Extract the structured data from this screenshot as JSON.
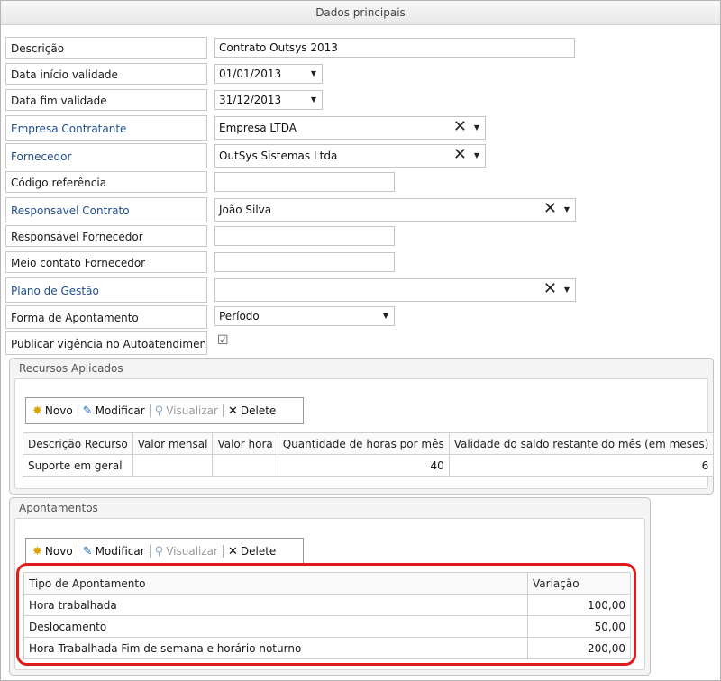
{
  "header": {
    "title": "Dados principais"
  },
  "fields": {
    "descricao": {
      "label": "Descrição",
      "value": "Contrato Outsys 2013"
    },
    "data_inicio": {
      "label": "Data início validade",
      "value": "01/01/2013"
    },
    "data_fim": {
      "label": "Data fim validade",
      "value": "31/12/2013"
    },
    "empresa": {
      "label": "Empresa Contratante",
      "value": "Empresa LTDA"
    },
    "fornecedor": {
      "label": "Fornecedor",
      "value": "OutSys Sistemas Ltda"
    },
    "codigo": {
      "label": "Código referência",
      "value": ""
    },
    "resp_contrato": {
      "label": "Responsavel Contrato",
      "value": "João Silva"
    },
    "resp_fornecedor": {
      "label": "Responsável Fornecedor",
      "value": ""
    },
    "meio_contato": {
      "label": "Meio contato Fornecedor",
      "value": ""
    },
    "plano": {
      "label": "Plano de Gestão",
      "value": ""
    },
    "forma": {
      "label": "Forma de Apontamento",
      "value": "Período"
    },
    "publicar": {
      "label": "Publicar vigência no Autoatendimento",
      "checked": true
    }
  },
  "toolbar": {
    "new": "Novo",
    "edit": "Modificar",
    "view": "Visualizar",
    "delete": "Delete"
  },
  "recursos": {
    "title": "Recursos Aplicados",
    "columns": [
      "Descrição Recurso",
      "Valor mensal",
      "Valor hora",
      "Quantidade de horas por mês",
      "Validade do saldo restante do mês (em meses)"
    ],
    "rows": [
      [
        "Suporte em geral",
        "",
        "",
        "40",
        "6"
      ]
    ]
  },
  "apontamentos": {
    "title": "Apontamentos",
    "columns": [
      "Tipo de Apontamento",
      "Variação"
    ],
    "rows": [
      [
        "Hora trabalhada",
        "100,00"
      ],
      [
        "Deslocamento",
        "50,00"
      ],
      [
        "Hora Trabalhada Fim de semana e horário noturno",
        "200,00"
      ]
    ]
  },
  "colors": {
    "link_label": "#1f4e8c",
    "highlight": "#e01b1b"
  }
}
